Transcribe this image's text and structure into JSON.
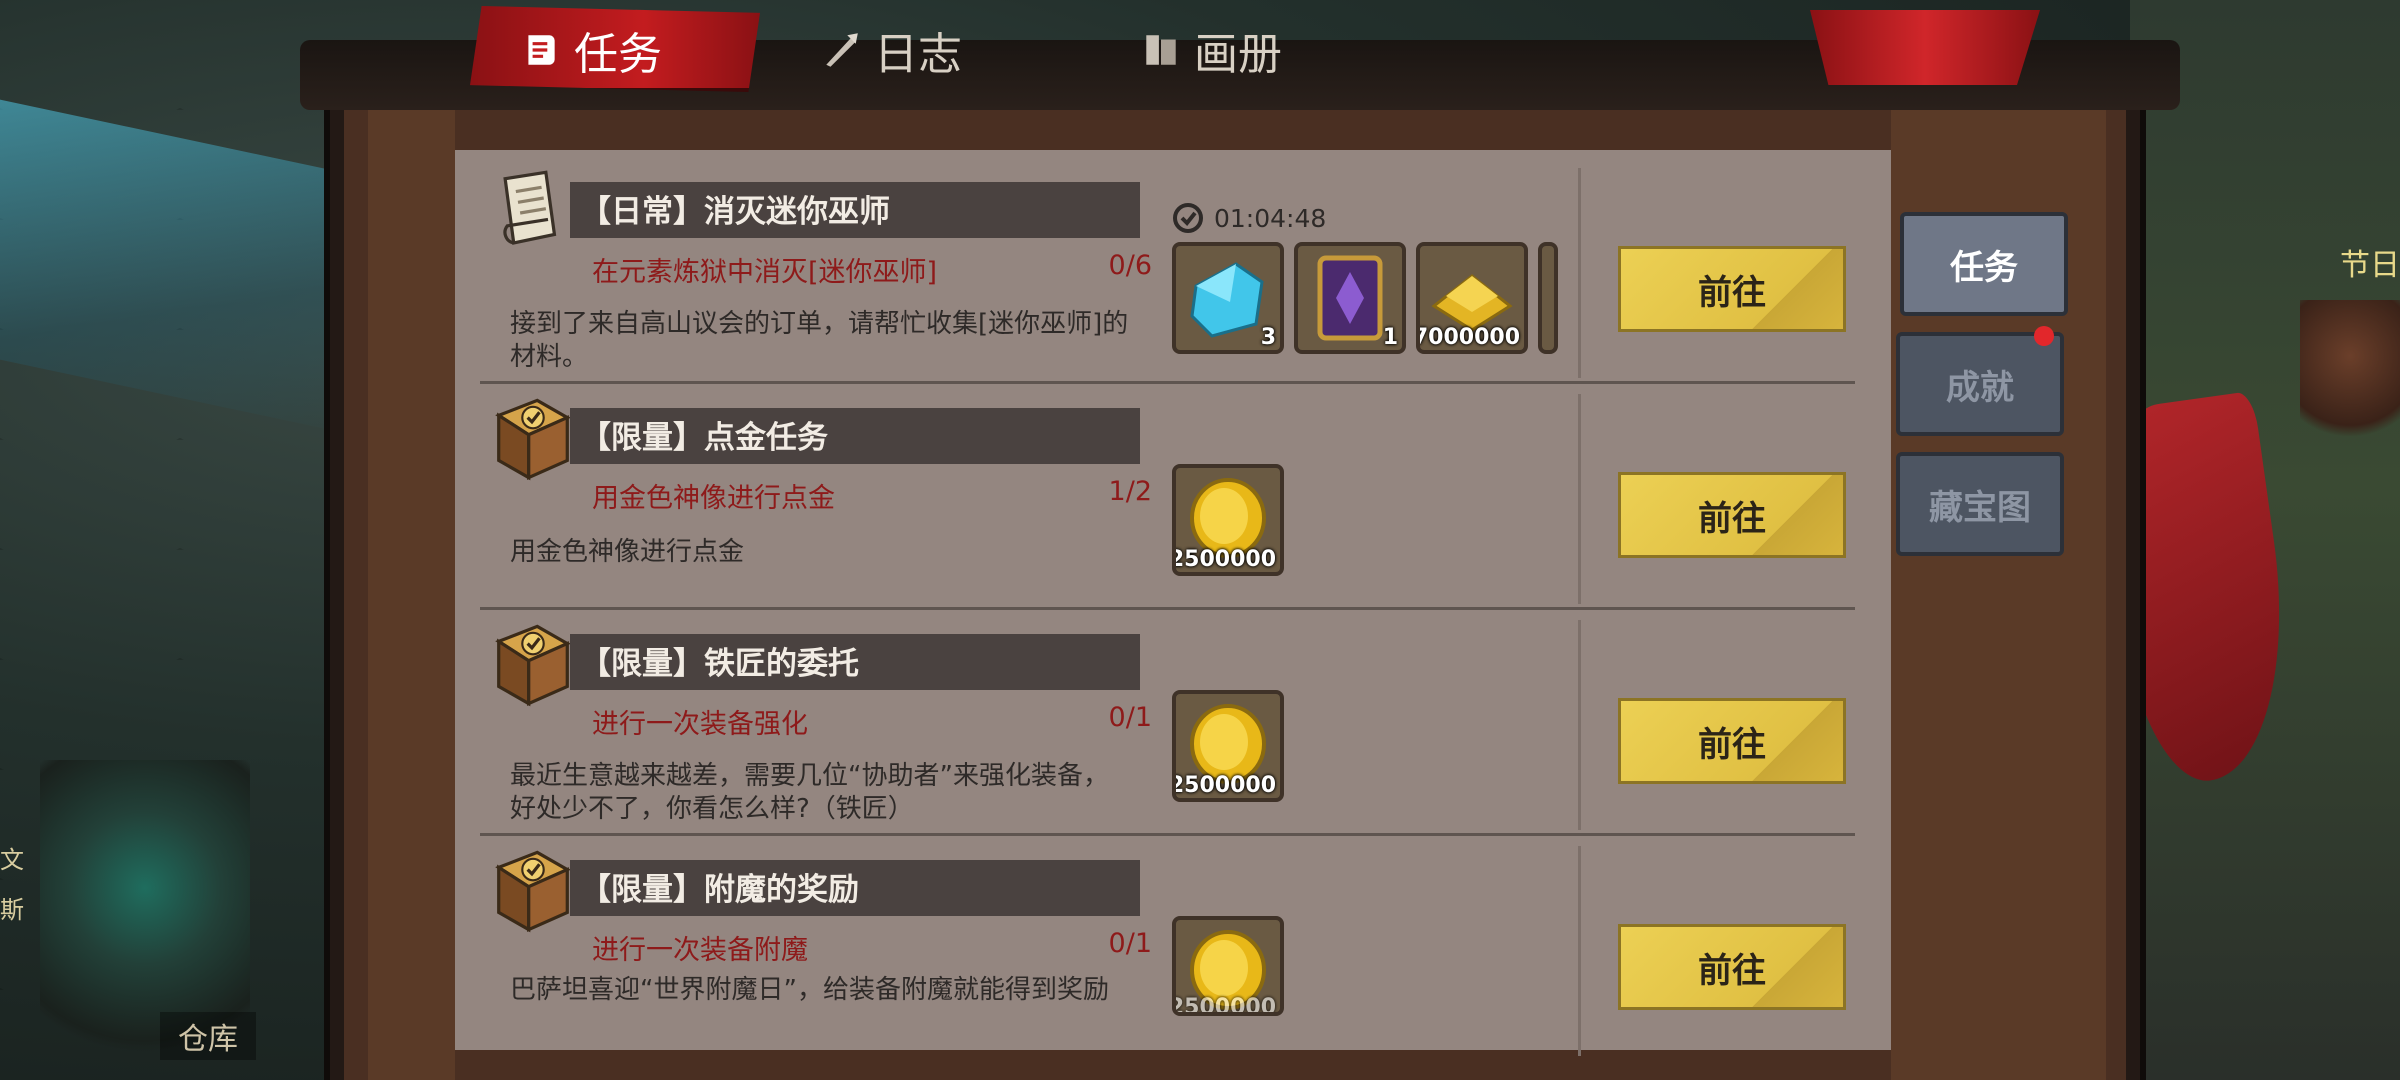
{
  "top_tabs": [
    {
      "label": "任务",
      "icon": "quest-scroll-icon",
      "active": true
    },
    {
      "label": "日志",
      "icon": "quill-icon",
      "active": false
    },
    {
      "label": "画册",
      "icon": "album-book-icon",
      "active": false
    }
  ],
  "side_tabs": [
    {
      "label": "任务",
      "active": true
    },
    {
      "label": "成就",
      "active": false,
      "notification": true
    },
    {
      "label": "藏宝图",
      "active": false
    }
  ],
  "quests": [
    {
      "icon": "scroll-icon",
      "title": "【日常】消灭迷你巫师",
      "objective": "在元素炼狱中消灭[迷你巫师]",
      "progress": "0/6",
      "description": "接到了来自高山议会的订单，请帮忙收集[迷你巫师]的材料。",
      "timer": "01:04:48",
      "rewards": [
        {
          "icon": "blue-crystal-icon",
          "count": "3"
        },
        {
          "icon": "purple-spellbook-icon",
          "count": "1"
        },
        {
          "icon": "gold-ingot-stack-icon",
          "count": "7000000"
        }
      ],
      "button": "前往"
    },
    {
      "icon": "quest-book-icon",
      "title": "【限量】点金任务",
      "objective": "用金色神像进行点金",
      "progress": "1/2",
      "description": "用金色神像进行点金",
      "rewards": [
        {
          "icon": "gold-coin-icon",
          "count": "2500000"
        }
      ],
      "button": "前往"
    },
    {
      "icon": "quest-book-icon",
      "title": "【限量】铁匠的委托",
      "objective": "进行一次装备强化",
      "progress": "0/1",
      "description": "最近生意越来越差，需要几位“协助者”来强化装备，好处少不了，你看怎么样?（铁匠）",
      "rewards": [
        {
          "icon": "gold-coin-icon",
          "count": "2500000"
        }
      ],
      "button": "前往"
    },
    {
      "icon": "quest-book-icon",
      "title": "【限量】附魔的奖励",
      "objective": "进行一次装备附魔",
      "progress": "0/1",
      "description": "巴萨坦喜迎“世界附魔日”，给装备附魔就能得到奖励",
      "rewards": [
        {
          "icon": "gold-coin-icon",
          "count": "2500000"
        }
      ],
      "button": "前往"
    }
  ],
  "scene": {
    "store_label": "仓库",
    "festival_label": "节日",
    "edge_chars": [
      "文",
      "斯"
    ]
  },
  "colors": {
    "objective_red": "#8e1a1a",
    "go_button_yellow": "#e0c043",
    "tab_active_red": "#c31c1f",
    "panel_bg": "#948680"
  }
}
